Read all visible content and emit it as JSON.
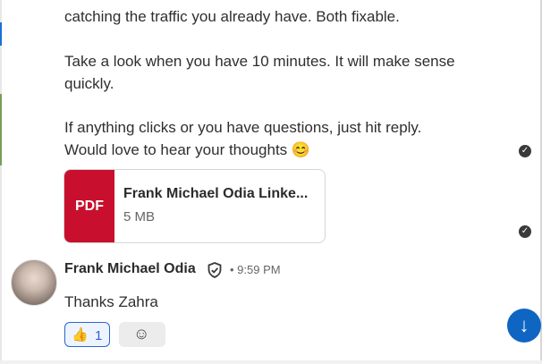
{
  "message": {
    "line1": "catching the traffic you already have. Both fixable.",
    "line2": "Take a look when you have 10 minutes. It will make sense",
    "line3": "quickly.",
    "line4": "If anything clicks or you have questions, just hit reply.",
    "line5": "Would love to hear your thoughts 😊"
  },
  "attachment": {
    "type_label": "PDF",
    "file_name": "Frank Michael Odia Linke...",
    "file_size": "5 MB"
  },
  "reply": {
    "sender": "Frank Michael Odia",
    "time": "• 9:59 PM",
    "text": "Thanks Zahra"
  },
  "reaction": {
    "emoji": "👍",
    "count": "1"
  },
  "icons": {
    "check": "check-circle-icon",
    "shield": "verified-shield-icon",
    "add_reaction": "add-emoji-icon",
    "scroll": "arrow-down-icon"
  },
  "colors": {
    "pdf_red": "#c8102e",
    "accent_blue": "#0f66c2"
  }
}
